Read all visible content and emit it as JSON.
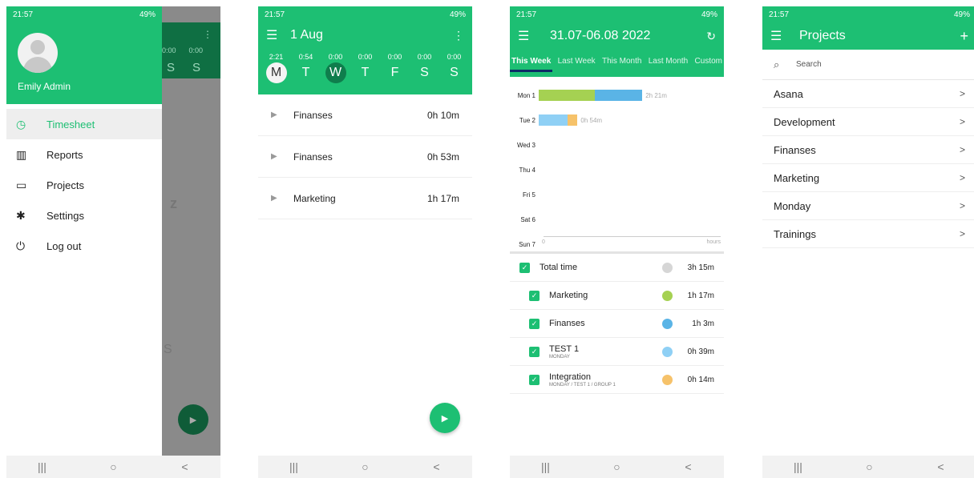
{
  "status": {
    "time": "21:57",
    "battery": "49%"
  },
  "nav": {
    "recent": "|||",
    "home": "○",
    "back": "<"
  },
  "drawer": {
    "user_name": "Emily Admin",
    "items": [
      {
        "label": "Timesheet",
        "icon": "clock-icon"
      },
      {
        "label": "Reports",
        "icon": "bar-chart-icon"
      },
      {
        "label": "Projects",
        "icon": "folder-icon"
      },
      {
        "label": "Settings",
        "icon": "gear-icon"
      },
      {
        "label": "Log out",
        "icon": "power-icon"
      }
    ],
    "overlay": {
      "times": [
        "0:00",
        "0:00"
      ],
      "letters": [
        "S",
        "S"
      ],
      "z": "z",
      "s": "S"
    }
  },
  "timesheet": {
    "title": "1 Aug",
    "day_times": [
      "2:21",
      "0:54",
      "0:00",
      "0:00",
      "0:00",
      "0:00",
      "0:00"
    ],
    "day_letters": [
      "M",
      "T",
      "W",
      "T",
      "F",
      "S",
      "S"
    ],
    "entries": [
      {
        "name": "Finanses",
        "duration": "0h 10m"
      },
      {
        "name": "Finanses",
        "duration": "0h 53m"
      },
      {
        "name": "Marketing",
        "duration": "1h 17m"
      }
    ]
  },
  "reports": {
    "title": "31.07-06.08 2022",
    "tabs": [
      "This Week",
      "Last Week",
      "This Month",
      "Last Month",
      "Custom"
    ],
    "axis": {
      "min_label": "0",
      "unit_label": "hours"
    },
    "legend": [
      {
        "name": "Total time",
        "sub": "",
        "time": "3h 15m",
        "color": "#d6d6d6"
      },
      {
        "name": "Marketing",
        "sub": "",
        "time": "1h 17m",
        "color": "#a5d152"
      },
      {
        "name": "Finanses",
        "sub": "",
        "time": "1h 3m",
        "color": "#5ab4e6"
      },
      {
        "name": "TEST 1",
        "sub": "MONDAY",
        "time": "0h 39m",
        "color": "#8fd0f5"
      },
      {
        "name": "Integration",
        "sub": "MONDAY / TEST 1 / GROUP 1",
        "time": "0h 14m",
        "color": "#f6c26a"
      }
    ]
  },
  "chart_data": {
    "type": "bar",
    "orientation": "horizontal",
    "stacked": true,
    "categories": [
      "Mon 1",
      "Tue 2",
      "Wed 3",
      "Thu 4",
      "Fri 5",
      "Sat 6",
      "Sun 7"
    ],
    "series": [
      {
        "name": "Marketing",
        "color": "#a5d152",
        "values": [
          1.28,
          0,
          0,
          0,
          0,
          0,
          0
        ]
      },
      {
        "name": "Finanses",
        "color": "#5ab4e6",
        "values": [
          1.07,
          0,
          0,
          0,
          0,
          0,
          0
        ]
      },
      {
        "name": "TEST 1",
        "color": "#8fd0f5",
        "values": [
          0,
          0.65,
          0,
          0,
          0,
          0,
          0
        ]
      },
      {
        "name": "Integration",
        "color": "#f6c26a",
        "values": [
          0,
          0.23,
          0,
          0,
          0,
          0,
          0
        ]
      }
    ],
    "totals": [
      "2h 21m",
      "0h 54m",
      "",
      "",
      "",
      "",
      ""
    ],
    "xlabel": "hours",
    "xlim": [
      0,
      4
    ]
  },
  "projects": {
    "title": "Projects",
    "search_placeholder": "Search",
    "items": [
      "Asana",
      "Development",
      "Finanses",
      "Marketing",
      "Monday",
      "Trainings"
    ]
  },
  "colors": {
    "brand": "#1dbf73",
    "dark": "#0f7d4c"
  }
}
